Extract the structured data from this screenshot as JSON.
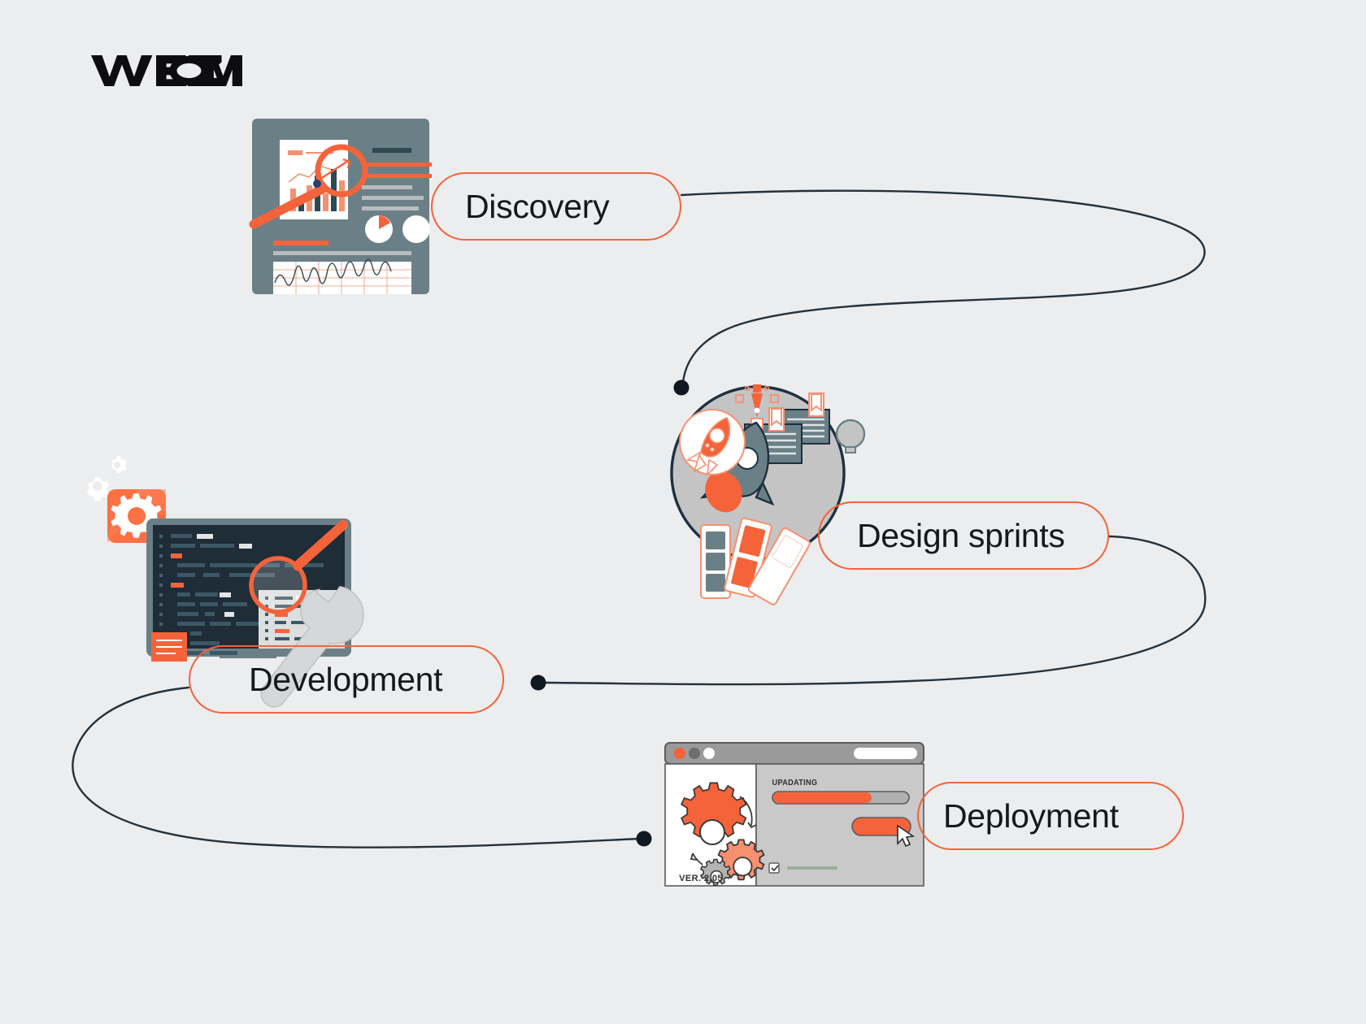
{
  "brand": {
    "logo_text": "WEZOM",
    "accent_color": "#f4633a",
    "slate_color": "#6b8086",
    "navy_color": "#1d3040",
    "gray_color": "#c4c4c4",
    "background_color": "#ecedef"
  },
  "diagram": {
    "type": "process-flow",
    "title": "",
    "stage_count": 4,
    "flow_order": [
      "Discovery",
      "Design sprints",
      "Development",
      "Deployment"
    ],
    "stages": [
      {
        "id": "discovery",
        "label": "Discovery",
        "illustration": "analytics-dashboard-with-magnifier"
      },
      {
        "id": "design-sprints",
        "label": "Design sprints",
        "illustration": "rocket-pen-tool-color-swatches"
      },
      {
        "id": "development",
        "label": "Development",
        "illustration": "monitor-with-code-gears-wrench"
      },
      {
        "id": "deployment",
        "label": "Deployment",
        "illustration": "browser-window-updating-gears"
      }
    ]
  },
  "deployment_window": {
    "status_label": "UPADATING",
    "version_label": "VER. 2.05",
    "progress_percent": 72,
    "traffic_lights": [
      "close-red",
      "minimize-gray",
      "maximize-white"
    ]
  }
}
